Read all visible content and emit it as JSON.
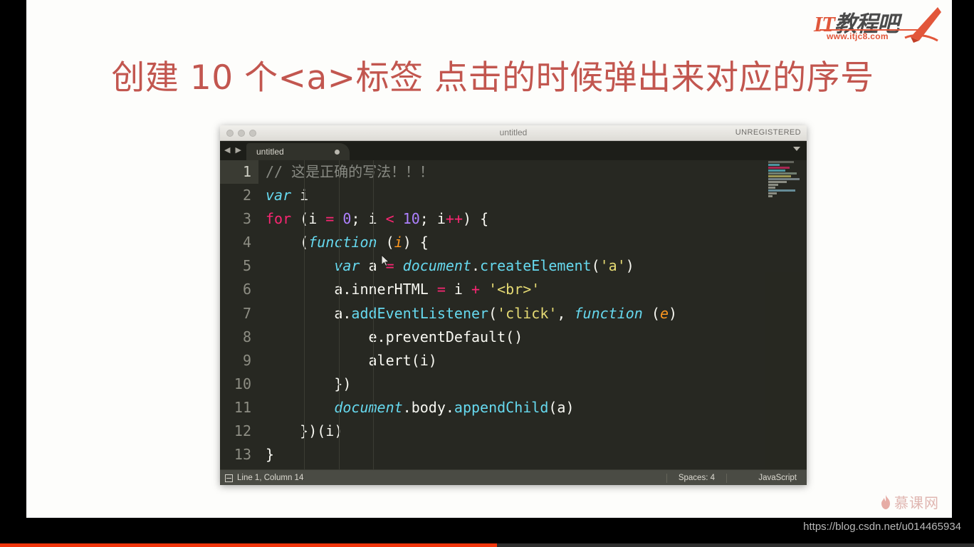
{
  "brand": {
    "name_it": "IT",
    "name_cn": "教程吧",
    "url": "www.itjc8.com",
    "pen_icon": "pen-icon"
  },
  "slide": {
    "title": "创建 10 个<a>标签 点击的时候弹出来对应的序号",
    "title_color": "#c2564f"
  },
  "editor": {
    "window_title": "untitled",
    "license_label": "UNREGISTERED",
    "nav_back_icon": "arrow-left-icon",
    "nav_forward_icon": "arrow-right-icon",
    "tab_label": "untitled",
    "tab_dirty_icon": "dirty-dot-icon",
    "tab_menu_icon": "chevron-down-icon",
    "traffic_lights": [
      "close-button",
      "minimize-button",
      "zoom-button"
    ],
    "line_numbers": [
      "1",
      "2",
      "3",
      "4",
      "5",
      "6",
      "7",
      "8",
      "9",
      "10",
      "11",
      "12",
      "13"
    ],
    "active_line": 1,
    "code_lines": [
      "// 这是正确的写法！！！",
      "var i",
      "for (i = 0; i < 10; i++) {",
      "    (function (i) {",
      "        var a = document.createElement('a')",
      "        a.innerHTML = i + '<br>'",
      "        a.addEventListener('click', function (e)",
      "            e.preventDefault()",
      "            alert(i)",
      "        })",
      "        document.body.appendChild(a)",
      "    })(i)",
      "}"
    ],
    "status": {
      "position": "Line 1, Column 14",
      "indent": "Spaces: 4",
      "syntax": "JavaScript",
      "status_icon": "panel-icon"
    },
    "theme": {
      "background": "#272822",
      "foreground": "#f8f8f2",
      "keyword": "#f92672",
      "type": "#66d9ef",
      "string": "#e6db74",
      "number": "#ae81ff",
      "comment": "#888a83",
      "param": "#fd971f",
      "gutter_text": "#8d8d83",
      "statusbar": "#4a4b44"
    }
  },
  "watermark": {
    "text": "慕课网",
    "flame_icon": "flame-icon"
  },
  "footer": {
    "url": "https://blog.csdn.net/u014465934",
    "progress_color": "#f0350b",
    "progress_percent": 51
  }
}
